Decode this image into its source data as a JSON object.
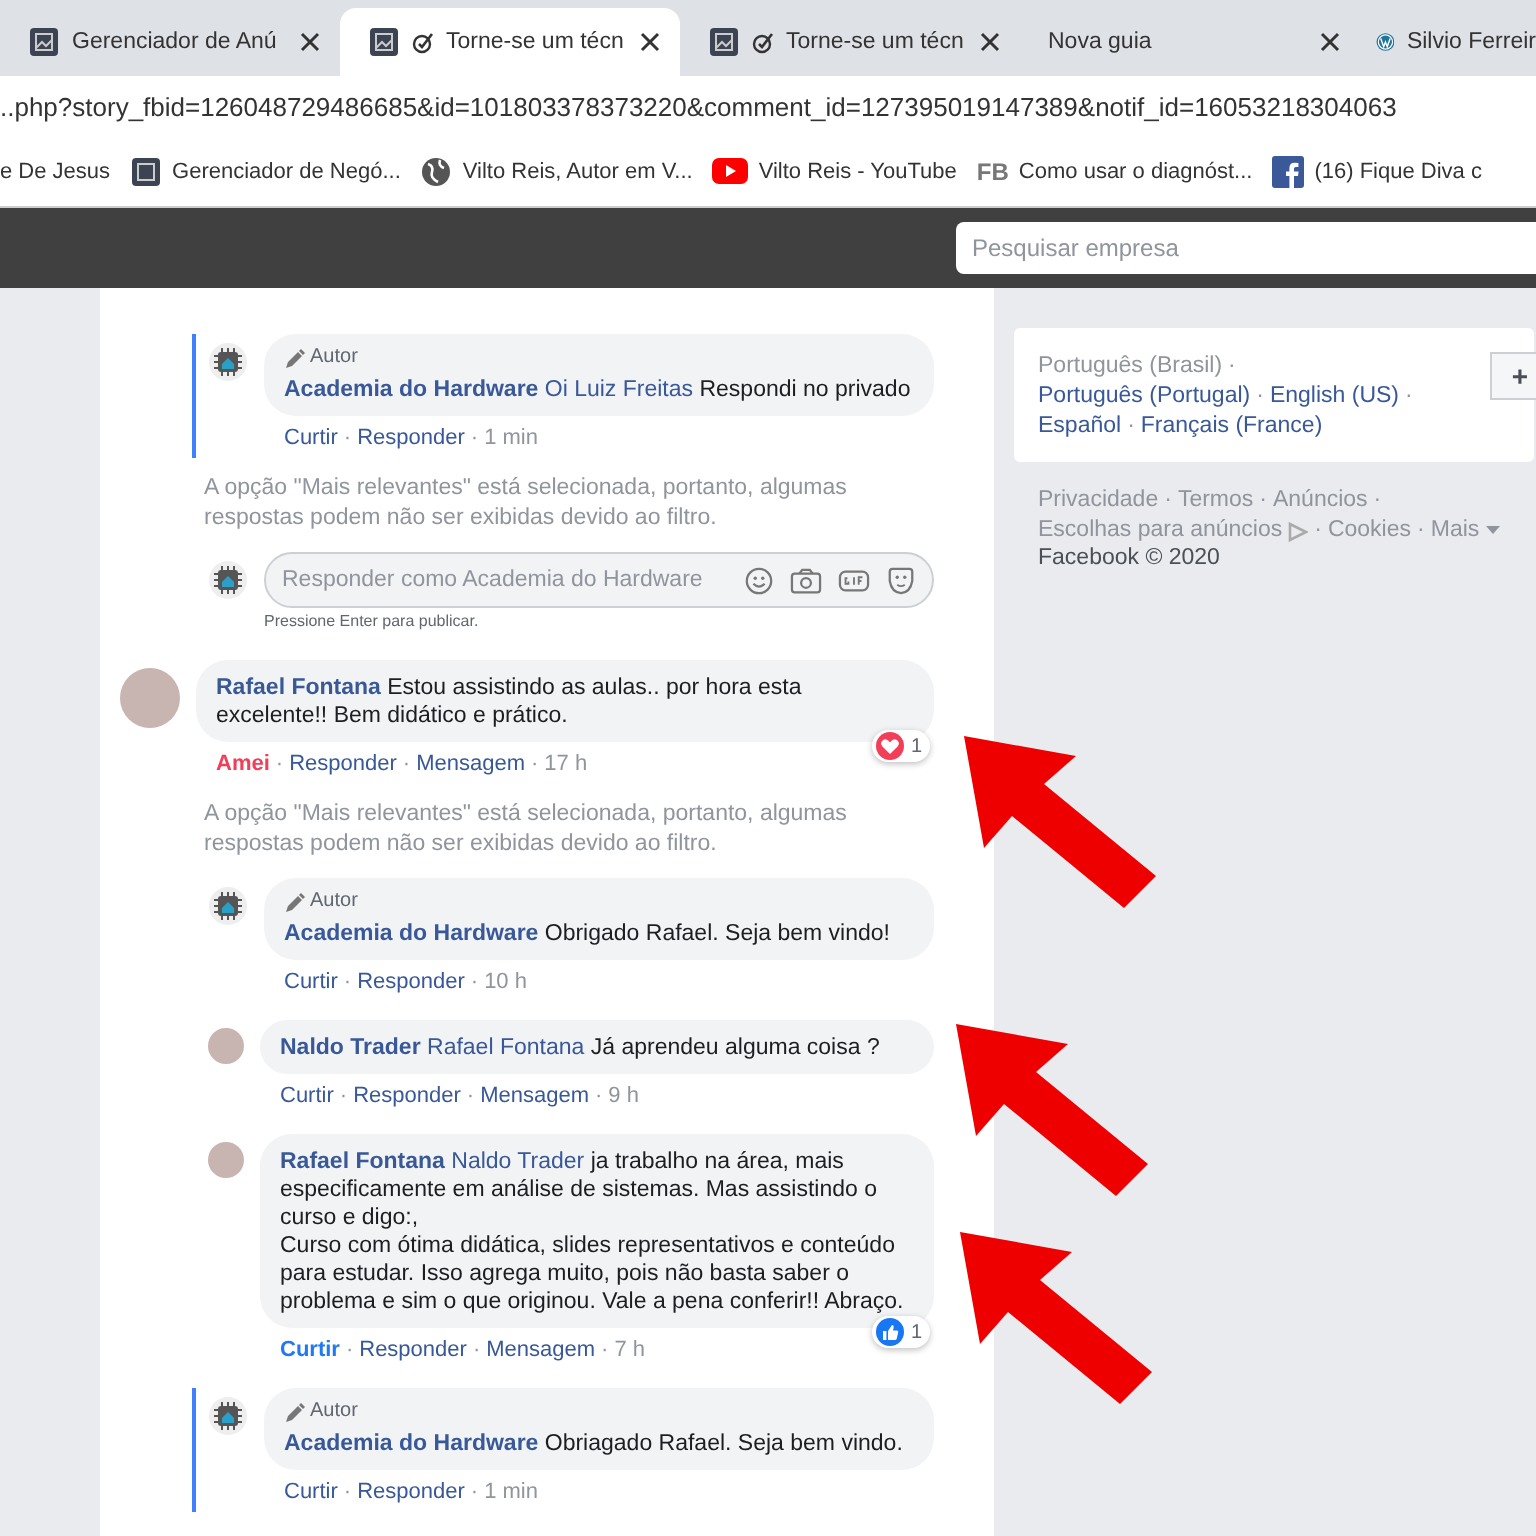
{
  "browser": {
    "tabs": [
      {
        "label": "Gerenciador de Anú",
        "selected": false,
        "marker": false
      },
      {
        "label": "Torne-se um técn",
        "selected": true,
        "marker": true
      },
      {
        "label": "Torne-se um técn",
        "selected": false,
        "marker": true
      },
      {
        "label": "Nova guia",
        "selected": false,
        "marker": false
      },
      {
        "label": "Silvio Ferreir",
        "selected": false,
        "marker": false
      }
    ],
    "address": "..php?story_fbid=126048729486685&id=101803378373220&comment_id=127395019147389&notif_id=16053218304063",
    "bookmarks": [
      {
        "label": "e De Jesus"
      },
      {
        "label": "Gerenciador de Negó..."
      },
      {
        "label": "Vilto Reis, Autor em V..."
      },
      {
        "label": "Vilto Reis - YouTube"
      },
      {
        "label": "Como usar o diagnóst...",
        "icon_text": "FB"
      },
      {
        "label": "(16) Fique Diva c"
      }
    ]
  },
  "header": {
    "search": {
      "placeholder": "Pesquisar empresa"
    }
  },
  "thread": [
    {
      "kind": "reply",
      "highlighted": true,
      "badge": "Autor",
      "author": "Academia do Hardware",
      "mention": "Oi Luiz Freitas",
      "text": "Respondi no privado",
      "liked": false,
      "actions": [
        "Curtir",
        "Responder"
      ],
      "separator": "·",
      "time": "1 min"
    },
    {
      "kind": "notice",
      "text": "A opção \"Mais relevantes\" está selecionada, portanto, algumas respostas podem não ser exibidas devido ao filtro."
    },
    {
      "kind": "composer",
      "placeholder": "Responder como Academia do Hardware",
      "hint": "Pressione Enter para publicar."
    },
    {
      "kind": "comment",
      "highlighted": false,
      "author": "Rafael Fontana",
      "text": "Estou assistindo as aulas.. por hora esta excelente!! Bem didático e prático.",
      "liked": true,
      "reaction": {
        "kind": "love",
        "count": "1"
      },
      "actions": [
        "Amei",
        "Responder",
        "Mensagem"
      ],
      "separator": "·",
      "time": "17 h",
      "children": [
        {
          "kind": "notice",
          "text": "A opção \"Mais relevantes\" está selecionada, portanto, algumas respostas podem não ser exibidas devido ao filtro."
        },
        {
          "kind": "reply",
          "highlighted": false,
          "badge": "Autor",
          "author": "Academia do Hardware",
          "text": "Obrigado Rafael. Seja bem vindo!",
          "liked": false,
          "actions": [
            "Curtir",
            "Responder"
          ],
          "separator": "·",
          "time": "10 h"
        },
        {
          "kind": "reply",
          "highlighted": false,
          "author": "Naldo Trader",
          "mention": "Rafael Fontana",
          "text": "Já aprendeu alguma coisa ?",
          "liked": false,
          "actions": [
            "Curtir",
            "Responder",
            "Mensagem"
          ],
          "separator": "·",
          "time": "9 h"
        },
        {
          "kind": "reply",
          "highlighted": false,
          "author": "Rafael Fontana",
          "mention": "Naldo Trader",
          "text": "ja trabalho na área, mais especificamente em análise de sistemas. Mas assistindo o curso e digo:,\nCurso com ótima didática, slides representativos e conteúdo para estudar. Isso agrega muito, pois não basta saber o problema e sim o que originou. Vale a pena conferir!! Abraço.",
          "liked": true,
          "reaction": {
            "kind": "like",
            "count": "1"
          },
          "actions": [
            "Curtir",
            "Responder",
            "Mensagem"
          ],
          "separator": "·",
          "time": "7 h"
        },
        {
          "kind": "reply",
          "highlighted": true,
          "badge": "Autor",
          "author": "Academia do Hardware",
          "text": "Obriagado Rafael. Seja bem vindo.",
          "liked": false,
          "actions": [
            "Curtir",
            "Responder"
          ],
          "separator": "·",
          "time": "1 min"
        }
      ]
    }
  ],
  "sidebar": {
    "current_language": "Português (Brasil)",
    "languages": [
      "Português (Portugal)",
      "English (US)",
      "Español",
      "Français (France)"
    ],
    "add_label": "+",
    "footer_links": [
      "Privacidade",
      "Termos",
      "Anúncios",
      "Escolhas para anúncios",
      "Cookies",
      "Mais"
    ],
    "separator": "·",
    "copyright": "Facebook © 2020"
  }
}
